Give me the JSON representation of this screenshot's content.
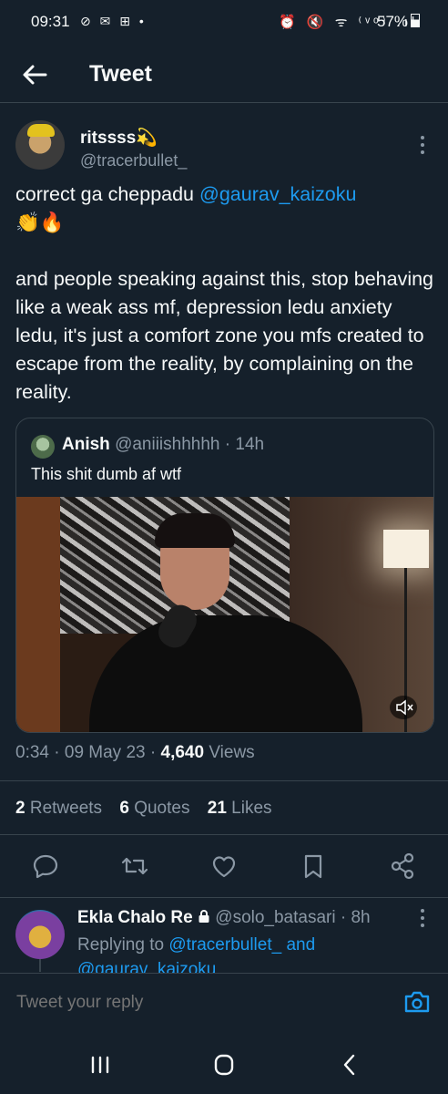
{
  "status_bar": {
    "time": "09:31",
    "left_icons": "⊘ ✉ ⊞ •",
    "right_icons": "⏰ 🔇 ᯤ ⁽ᵛᵒ⁾ .ıl",
    "battery": "57%"
  },
  "header": {
    "title": "Tweet"
  },
  "tweet": {
    "display_name": "ritssss💫",
    "handle": "@tracerbullet_",
    "line1": "correct ga cheppadu ",
    "mention": "@gaurav_kaizoku",
    "emojis": "👏🔥",
    "paragraph": "and people speaking against this, stop behaving like a weak ass mf, depression ledu anxiety ledu, it's just a comfort zone you mfs created to escape from the reality, by complaining on the reality.",
    "time": "0:34",
    "date": "09 May 23",
    "views_count": "4,640",
    "views_label": "Views"
  },
  "quoted": {
    "display_name": "Anish",
    "handle": "@aniiishhhhh",
    "age": "14h",
    "text": "This shit dumb af wtf"
  },
  "stats": {
    "retweets_count": "2",
    "retweets_label": "Retweets",
    "quotes_count": "6",
    "quotes_label": "Quotes",
    "likes_count": "21",
    "likes_label": "Likes"
  },
  "reply": {
    "display_name": "Ekla Chalo Re",
    "handle": "@solo_batasari",
    "age": "8h",
    "replying_to": "Replying to",
    "mention1": "@tracerbullet_",
    "and": "and",
    "mention2": "@gaurav_kaizoku"
  },
  "composer": {
    "placeholder": "Tweet your reply"
  },
  "colors": {
    "background": "#15202b",
    "accent": "#1d9bf0",
    "muted": "#8b98a5",
    "divider": "#38444d"
  }
}
